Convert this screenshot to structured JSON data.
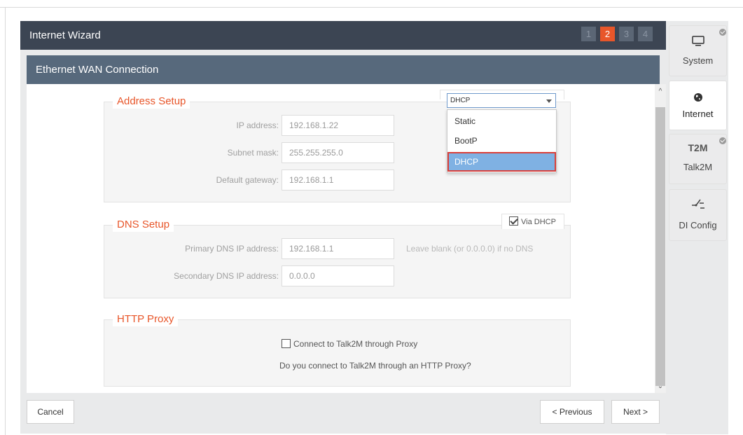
{
  "wizard": {
    "title": "Internet Wizard",
    "steps": [
      "1",
      "2",
      "3",
      "4"
    ],
    "active_step": "2"
  },
  "section": {
    "title": "Ethernet WAN Connection"
  },
  "address_setup": {
    "legend": "Address Setup",
    "mode_selected": "DHCP",
    "mode_options": [
      "Static",
      "BootP",
      "DHCP"
    ],
    "ip_label": "IP address:",
    "ip_value": "192.168.1.22",
    "mask_label": "Subnet mask:",
    "mask_value": "255.255.255.0",
    "gateway_label": "Default gateway:",
    "gateway_value": "192.168.1.1"
  },
  "dns_setup": {
    "legend": "DNS Setup",
    "via_dhcp_label": "Via DHCP",
    "via_dhcp_checked": true,
    "primary_label": "Primary DNS IP address:",
    "primary_value": "192.168.1.1",
    "primary_hint": "Leave blank (or 0.0.0.0) if no DNS",
    "secondary_label": "Secondary DNS IP address:",
    "secondary_value": "0.0.0.0"
  },
  "http_proxy": {
    "legend": "HTTP Proxy",
    "checkbox_label": "Connect to Talk2M through Proxy",
    "checked": false,
    "question": "Do you connect to Talk2M through an HTTP Proxy?"
  },
  "footer": {
    "cancel": "Cancel",
    "previous": "< Previous",
    "next": "Next >"
  },
  "sidebar": {
    "tabs": [
      {
        "label": "System",
        "icon": "monitor-icon",
        "badge": true
      },
      {
        "label": "Internet",
        "icon": "globe-icon",
        "badge": false,
        "active": true
      },
      {
        "label": "Talk2M",
        "icon_text": "T2M",
        "icon": "talk2m-icon",
        "badge": true
      },
      {
        "label": "DI Config",
        "icon": "switch-icon",
        "badge": false
      }
    ]
  }
}
